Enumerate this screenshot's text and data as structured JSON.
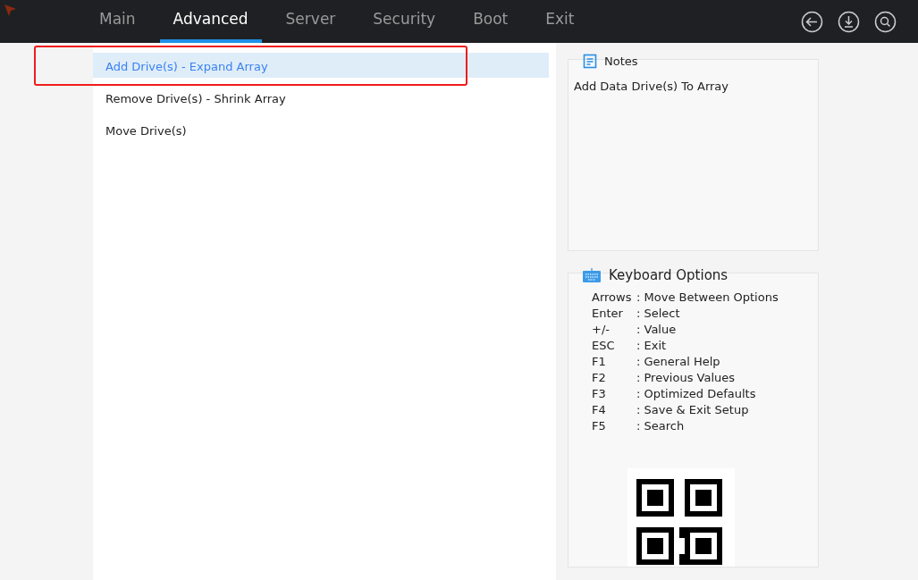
{
  "tabs": [
    {
      "label": "Main",
      "selected": false
    },
    {
      "label": "Advanced",
      "selected": true
    },
    {
      "label": "Server",
      "selected": false
    },
    {
      "label": "Security",
      "selected": false
    },
    {
      "label": "Boot",
      "selected": false
    },
    {
      "label": "Exit",
      "selected": false
    }
  ],
  "menu_items": [
    {
      "label": "Add Drive(s) - Expand Array",
      "selected": true
    },
    {
      "label": "Remove Drive(s) - Shrink Array",
      "selected": false
    },
    {
      "label": "Move Drive(s)",
      "selected": false
    }
  ],
  "notes": {
    "title": "Notes",
    "text": "Add Data Drive(s) To Array"
  },
  "keyboard_options": {
    "title": "Keyboard Options",
    "keys": [
      {
        "key": "Arrows",
        "action": ": Move Between Options"
      },
      {
        "key": "Enter",
        "action": ": Select"
      },
      {
        "key": "+/-",
        "action": ": Value"
      },
      {
        "key": "ESC",
        "action": ": Exit"
      },
      {
        "key": "F1",
        "action": ": General Help"
      },
      {
        "key": "F2",
        "action": ": Previous Values"
      },
      {
        "key": "F3",
        "action": ": Optimized Defaults"
      },
      {
        "key": "F4",
        "action": ": Save & Exit Setup"
      },
      {
        "key": "F5",
        "action": ": Search"
      }
    ]
  }
}
